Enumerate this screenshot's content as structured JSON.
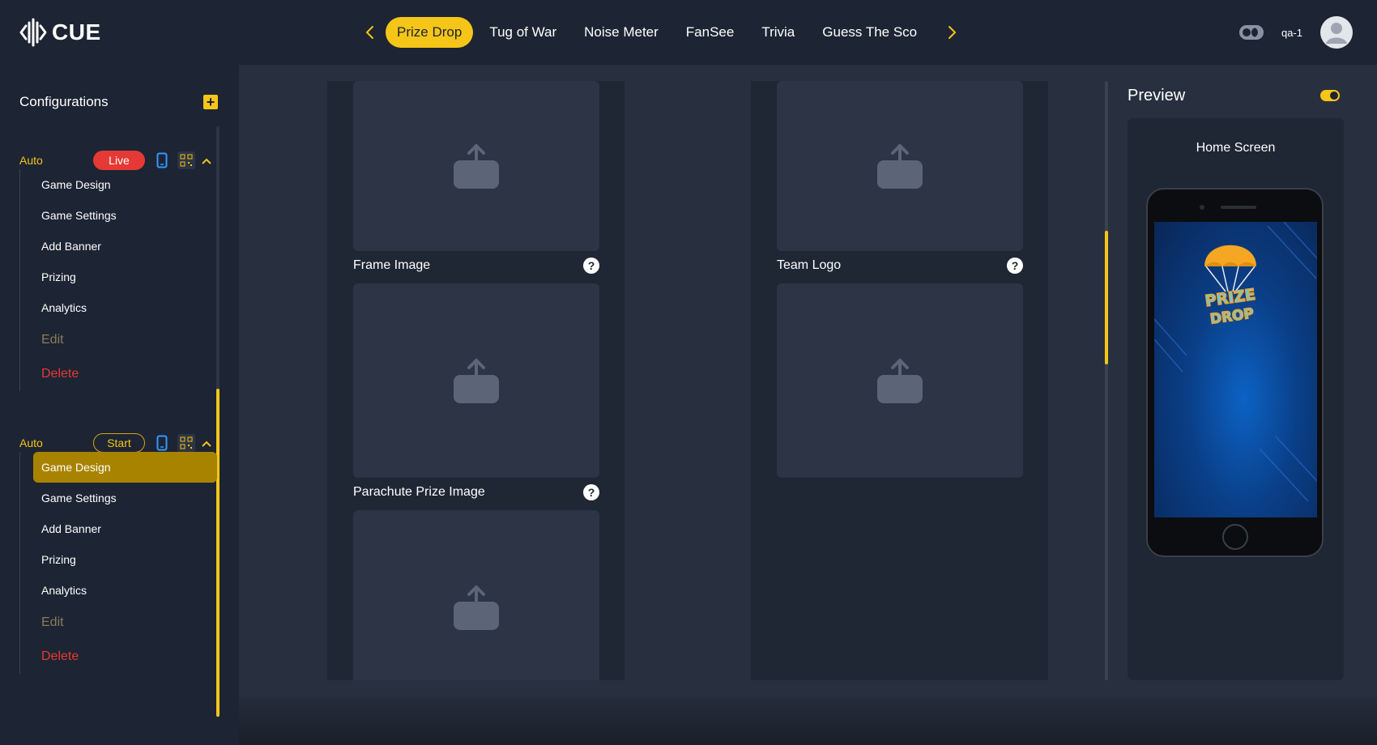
{
  "header": {
    "logo_text": "CUE",
    "tabs": [
      {
        "label": "Prize Drop",
        "active": true
      },
      {
        "label": "Tug of War",
        "active": false
      },
      {
        "label": "Noise Meter",
        "active": false
      },
      {
        "label": "FanSee",
        "active": false
      },
      {
        "label": "Trivia",
        "active": false
      },
      {
        "label": "Guess The Sco",
        "active": false
      }
    ],
    "username": "qa-1",
    "icons": {
      "prev": "chevron-left-icon",
      "next": "chevron-right-icon",
      "theme": "theme-toggle-icon",
      "avatar": "user-avatar-icon"
    }
  },
  "sidebar": {
    "title": "Configurations",
    "add_icon": "plus-icon",
    "groups": [
      {
        "label": "Auto",
        "status": "Live",
        "items": [
          "Game Design",
          "Game Settings",
          "Add Banner",
          "Prizing",
          "Analytics",
          "Edit",
          "Delete"
        ],
        "active_item": null
      },
      {
        "label": "Auto",
        "status": "Start",
        "items": [
          "Game Design",
          "Game Settings",
          "Add Banner",
          "Prizing",
          "Analytics",
          "Edit",
          "Delete"
        ],
        "active_item": "Game Design"
      }
    ]
  },
  "main": {
    "left_column": {
      "fields": [
        "Frame Image",
        "Parachute Prize Image"
      ]
    },
    "right_column": {
      "fields": [
        "Team Logo"
      ]
    },
    "help_glyph": "?"
  },
  "preview": {
    "title": "Preview",
    "screen_label": "Home Screen",
    "logo_text_line1": "PRIZE",
    "logo_text_line2": "DROP"
  },
  "colors": {
    "accent": "#f5c518",
    "live": "#e53935",
    "background": "#1d2433",
    "panel": "#28303f"
  }
}
